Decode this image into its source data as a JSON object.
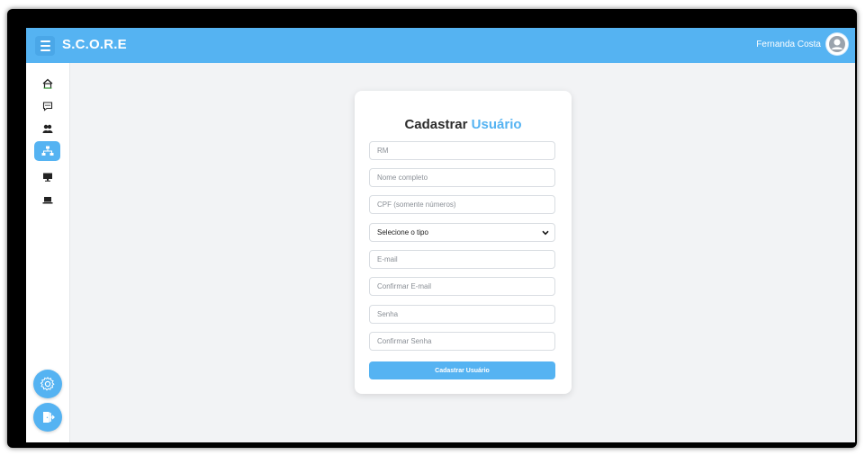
{
  "header": {
    "app_name": "S.C.O.R.E",
    "user_name": "Fernanda Costa"
  },
  "sidebar": {
    "items": [
      {
        "icon": "home-icon"
      },
      {
        "icon": "chat-icon"
      },
      {
        "icon": "users-icon"
      },
      {
        "icon": "network-icon",
        "active": true
      },
      {
        "icon": "monitor-icon"
      },
      {
        "icon": "laptop-icon"
      }
    ],
    "settings_icon": "gear-icon",
    "logout_icon": "logout-icon"
  },
  "form": {
    "title_prefix": "Cadastrar",
    "title_highlight": "Usuário",
    "fields": {
      "rm": "RM",
      "full_name": "Nome completo",
      "cpf": "CPF (somente números)",
      "email": "E-mail",
      "confirm_email": "Confirmar E-mail",
      "password": "Senha",
      "confirm_password": "Confirmar Senha"
    },
    "type_select": "Selecione o tipo",
    "submit_label": "Cadastrar Usuário"
  },
  "colors": {
    "accent": "#55b3f2",
    "background": "#f2f3f5"
  }
}
